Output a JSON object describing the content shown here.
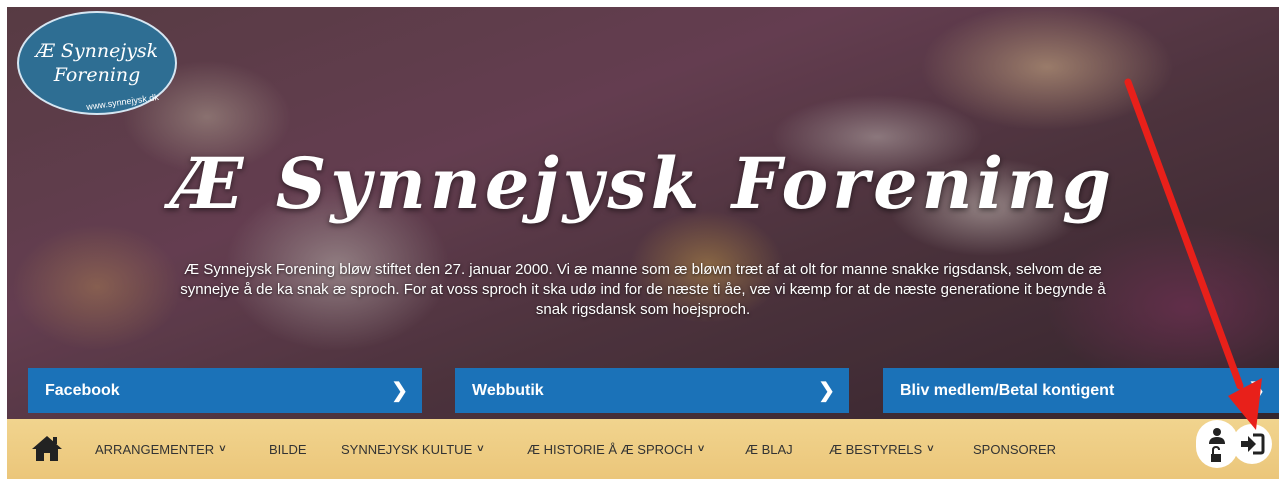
{
  "logo": {
    "line1": "Æ Synnejysk",
    "line2": "Forening",
    "url": "www.synnejysk.dk"
  },
  "hero": {
    "title": "Æ Synnejysk Forening",
    "intro": "Æ Synnejysk Forening bløw stiftet den 27. januar 2000. Vi æ manne som æ bløwn træt af at olt for manne snakke rigsdansk, selvom de æ synnejye å de ka snak æ sproch. For at voss sproch it ska udø ind for de næste ti åe, væ vi kæmp for at de næste generatione it begynde å snak rigsdansk som hoejsproch."
  },
  "buttons": [
    {
      "label": "Facebook",
      "icon": "chevron-right-icon"
    },
    {
      "label": "Webbutik",
      "icon": "chevron-right-icon"
    },
    {
      "label": "Bliv medlem/Betal kontigent",
      "icon": "chevron-right-icon"
    }
  ],
  "nav": {
    "home_icon": "home-icon",
    "items": [
      {
        "label": "ARRANGEMENTER",
        "dropdown": true
      },
      {
        "label": "BILDE",
        "dropdown": false
      },
      {
        "label": "SYNNEJYSK KULTUE",
        "dropdown": true
      },
      {
        "label": "Æ HISTORIE Å Æ SPROCH",
        "dropdown": true
      },
      {
        "label": "Æ BLAJ",
        "dropdown": false
      },
      {
        "label": "Æ BESTYRELS",
        "dropdown": true
      },
      {
        "label": "SPONSORER",
        "dropdown": false
      }
    ]
  },
  "colors": {
    "button_blue": "#1b72b8",
    "nav_gold": "#ebc67a",
    "annotation_arrow": "#e8201a"
  }
}
